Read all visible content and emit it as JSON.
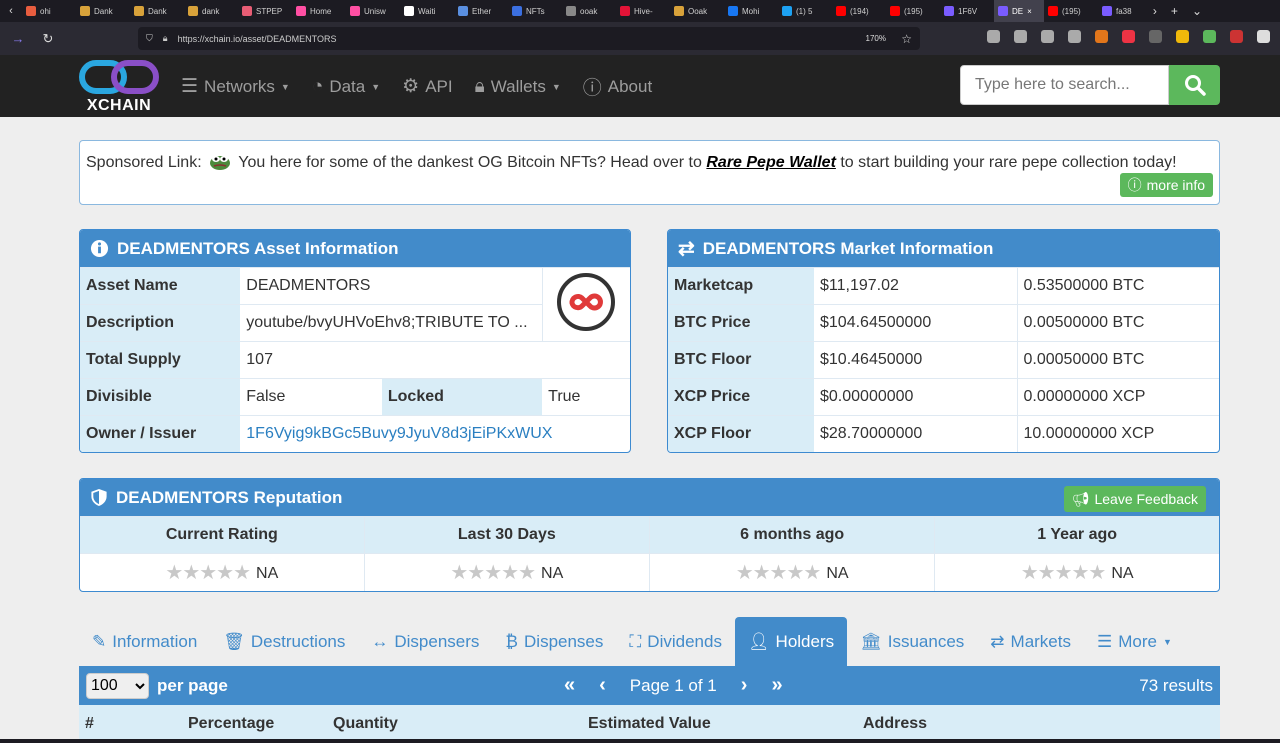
{
  "browser": {
    "tabs": [
      {
        "label": "ohi",
        "color": "#e85d3f"
      },
      {
        "label": "Dank",
        "color": "#d8a23a"
      },
      {
        "label": "Dank",
        "color": "#d8a23a"
      },
      {
        "label": "dank",
        "color": "#d8a23a"
      },
      {
        "label": "STPEP",
        "color": "#e85d75"
      },
      {
        "label": "Home",
        "color": "#ff4fa3"
      },
      {
        "label": "Unisw",
        "color": "#ff4fa3"
      },
      {
        "label": "Waiti",
        "color": "#ffffff"
      },
      {
        "label": "Ether",
        "color": "#5a8fe0"
      },
      {
        "label": "NFTs",
        "color": "#3b6fe0"
      },
      {
        "label": "ooak",
        "color": "#888888"
      },
      {
        "label": "Hive-",
        "color": "#e31337"
      },
      {
        "label": "Ooak",
        "color": "#d8a23a"
      },
      {
        "label": "Mohi",
        "color": "#1877f2"
      },
      {
        "label": "(1) 5",
        "color": "#1da1f2"
      },
      {
        "label": "(194)",
        "color": "#ff0000"
      },
      {
        "label": "(195)",
        "color": "#ff0000"
      },
      {
        "label": "1F6V",
        "color": "#7a5cff"
      },
      {
        "label": "DE",
        "color": "#7a5cff",
        "active": true
      },
      {
        "label": "(195)",
        "color": "#ff0000"
      },
      {
        "label": "fa38",
        "color": "#7a5cff"
      }
    ],
    "url": "https://xchain.io/asset/DEADMENTORS",
    "zoom": "170%"
  },
  "header": {
    "logo_text": "XCHAIN",
    "menu": [
      {
        "label": "Networks",
        "icon": "database-icon",
        "caret": true
      },
      {
        "label": "Data",
        "icon": "dashboard-icon",
        "caret": true
      },
      {
        "label": "API",
        "icon": "gears-icon",
        "caret": false
      },
      {
        "label": "Wallets",
        "icon": "lock-icon",
        "caret": true
      },
      {
        "label": "About",
        "icon": "info-icon",
        "caret": false
      }
    ],
    "search_placeholder": "Type here to search..."
  },
  "sponsor": {
    "prefix": "Sponsored Link:",
    "text_before": "You here for some of the dankest OG Bitcoin NFTs? Head over to",
    "link": "Rare Pepe Wallet",
    "text_after": "to start building your rare pepe collection today!",
    "more_info": "more info"
  },
  "asset_info": {
    "title": "DEADMENTORS Asset Information",
    "asset_name_label": "Asset Name",
    "asset_name": "DEADMENTORS",
    "description_label": "Description",
    "description": "youtube/bvyUHVoEhv8;TRIBUTE TO ...",
    "supply_label": "Total Supply",
    "supply": "107",
    "divisible_label": "Divisible",
    "divisible": "False",
    "locked_label": "Locked",
    "locked": "True",
    "owner_label": "Owner / Issuer",
    "owner": "1F6Vyig9kBGc5Buvy9JyuV8d3jEiPKxWUX"
  },
  "market_info": {
    "title": "DEADMENTORS Market Information",
    "rows": [
      {
        "label": "Marketcap",
        "usd": "$11,197.02",
        "native": "0.53500000 BTC"
      },
      {
        "label": "BTC Price",
        "usd": "$104.64500000",
        "native": "0.00500000 BTC"
      },
      {
        "label": "BTC Floor",
        "usd": "$10.46450000",
        "native": "0.00050000 BTC"
      },
      {
        "label": "XCP Price",
        "usd": "$0.00000000",
        "native": "0.00000000 XCP"
      },
      {
        "label": "XCP Floor",
        "usd": "$28.70000000",
        "native": "10.00000000 XCP"
      }
    ]
  },
  "reputation": {
    "title": "DEADMENTORS Reputation",
    "feedback": "Leave Feedback",
    "stars_glyph": "★★★★★",
    "columns": [
      {
        "label": "Current Rating",
        "value": "NA"
      },
      {
        "label": "Last 30 Days",
        "value": "NA"
      },
      {
        "label": "6 months ago",
        "value": "NA"
      },
      {
        "label": "1 Year ago",
        "value": "NA"
      }
    ]
  },
  "tabs": [
    {
      "label": "Information",
      "icon": "pencil-icon"
    },
    {
      "label": "Destructions",
      "icon": "trash-icon"
    },
    {
      "label": "Dispensers",
      "icon": "arrows-h-icon"
    },
    {
      "label": "Dispenses",
      "icon": "bitcoin-icon"
    },
    {
      "label": "Dividends",
      "icon": "sitemap-icon"
    },
    {
      "label": "Holders",
      "icon": "user-icon",
      "active": true
    },
    {
      "label": "Issuances",
      "icon": "bank-icon"
    },
    {
      "label": "Markets",
      "icon": "exchange-icon"
    },
    {
      "label": "More",
      "icon": "list-icon",
      "caret": true
    }
  ],
  "holders": {
    "per_page_value": "100",
    "per_page_label": "per page",
    "page_text": "Page 1 of 1",
    "results": "73 results",
    "columns": [
      "#",
      "Percentage",
      "Quantity",
      "Estimated Value",
      "Address"
    ]
  },
  "colors": {
    "primary": "#428bca",
    "success": "#5cb85c",
    "header_bg": "#222222",
    "light_blue": "#d9edf7"
  }
}
